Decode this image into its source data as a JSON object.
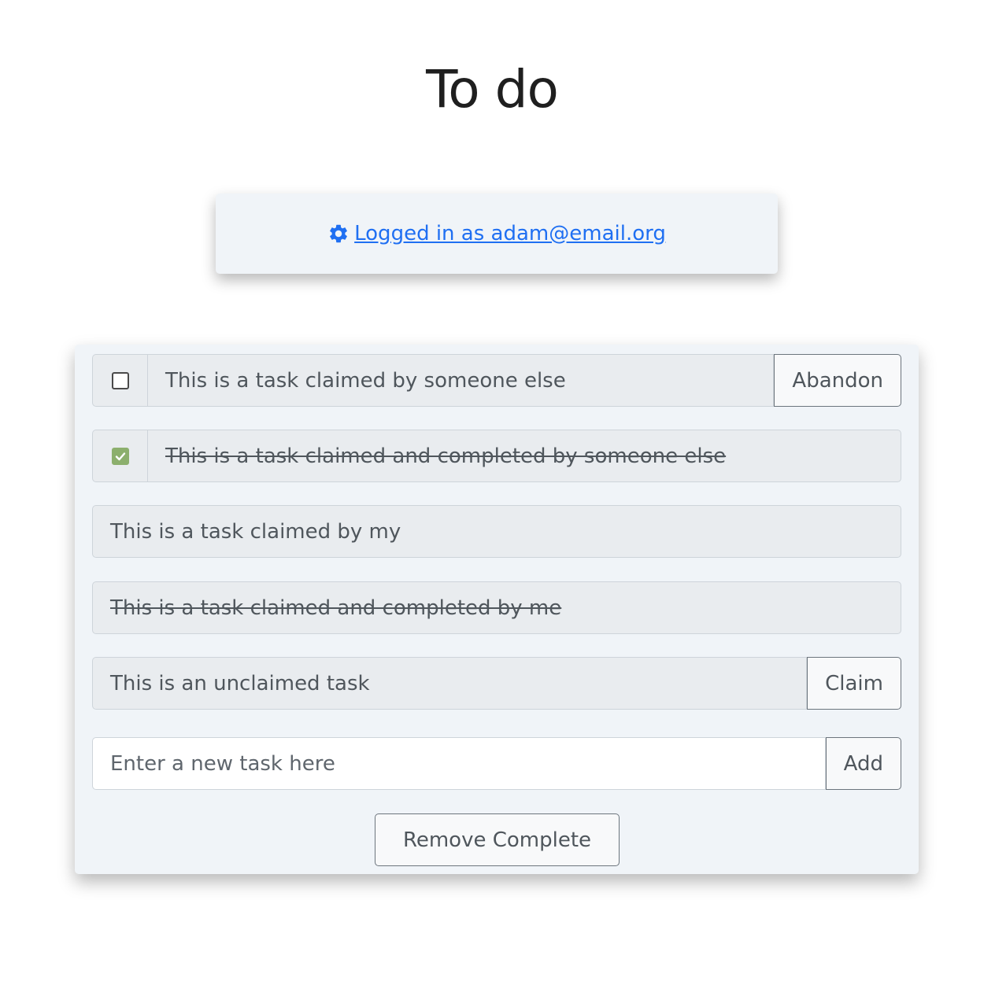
{
  "header": {
    "title": "To do"
  },
  "login": {
    "icon": "gear-icon",
    "link_text": "Logged in as adam@email.org",
    "link_color": "#1f6ff2"
  },
  "tasks": [
    {
      "text": "This is a task claimed by someone else",
      "has_checkbox": true,
      "checked": false,
      "completed": false,
      "action_label": "Abandon"
    },
    {
      "text": "This is a task claimed and completed by someone else",
      "has_checkbox": true,
      "checked": true,
      "completed": true
    },
    {
      "text": "This is a task claimed by my",
      "has_checkbox": false,
      "completed": false
    },
    {
      "text": "This is a task claimed and completed by me",
      "has_checkbox": false,
      "completed": true
    },
    {
      "text": "This is an unclaimed task",
      "has_checkbox": false,
      "completed": false,
      "action_label": "Claim"
    }
  ],
  "new_task": {
    "placeholder": "Enter a new task here",
    "value": "",
    "add_label": "Add"
  },
  "footer": {
    "remove_complete_label": "Remove Complete"
  },
  "colors": {
    "card_background": "#f0f4f8",
    "checked_checkbox": "#8caf6d",
    "readonly_field": "#e9ecef"
  }
}
